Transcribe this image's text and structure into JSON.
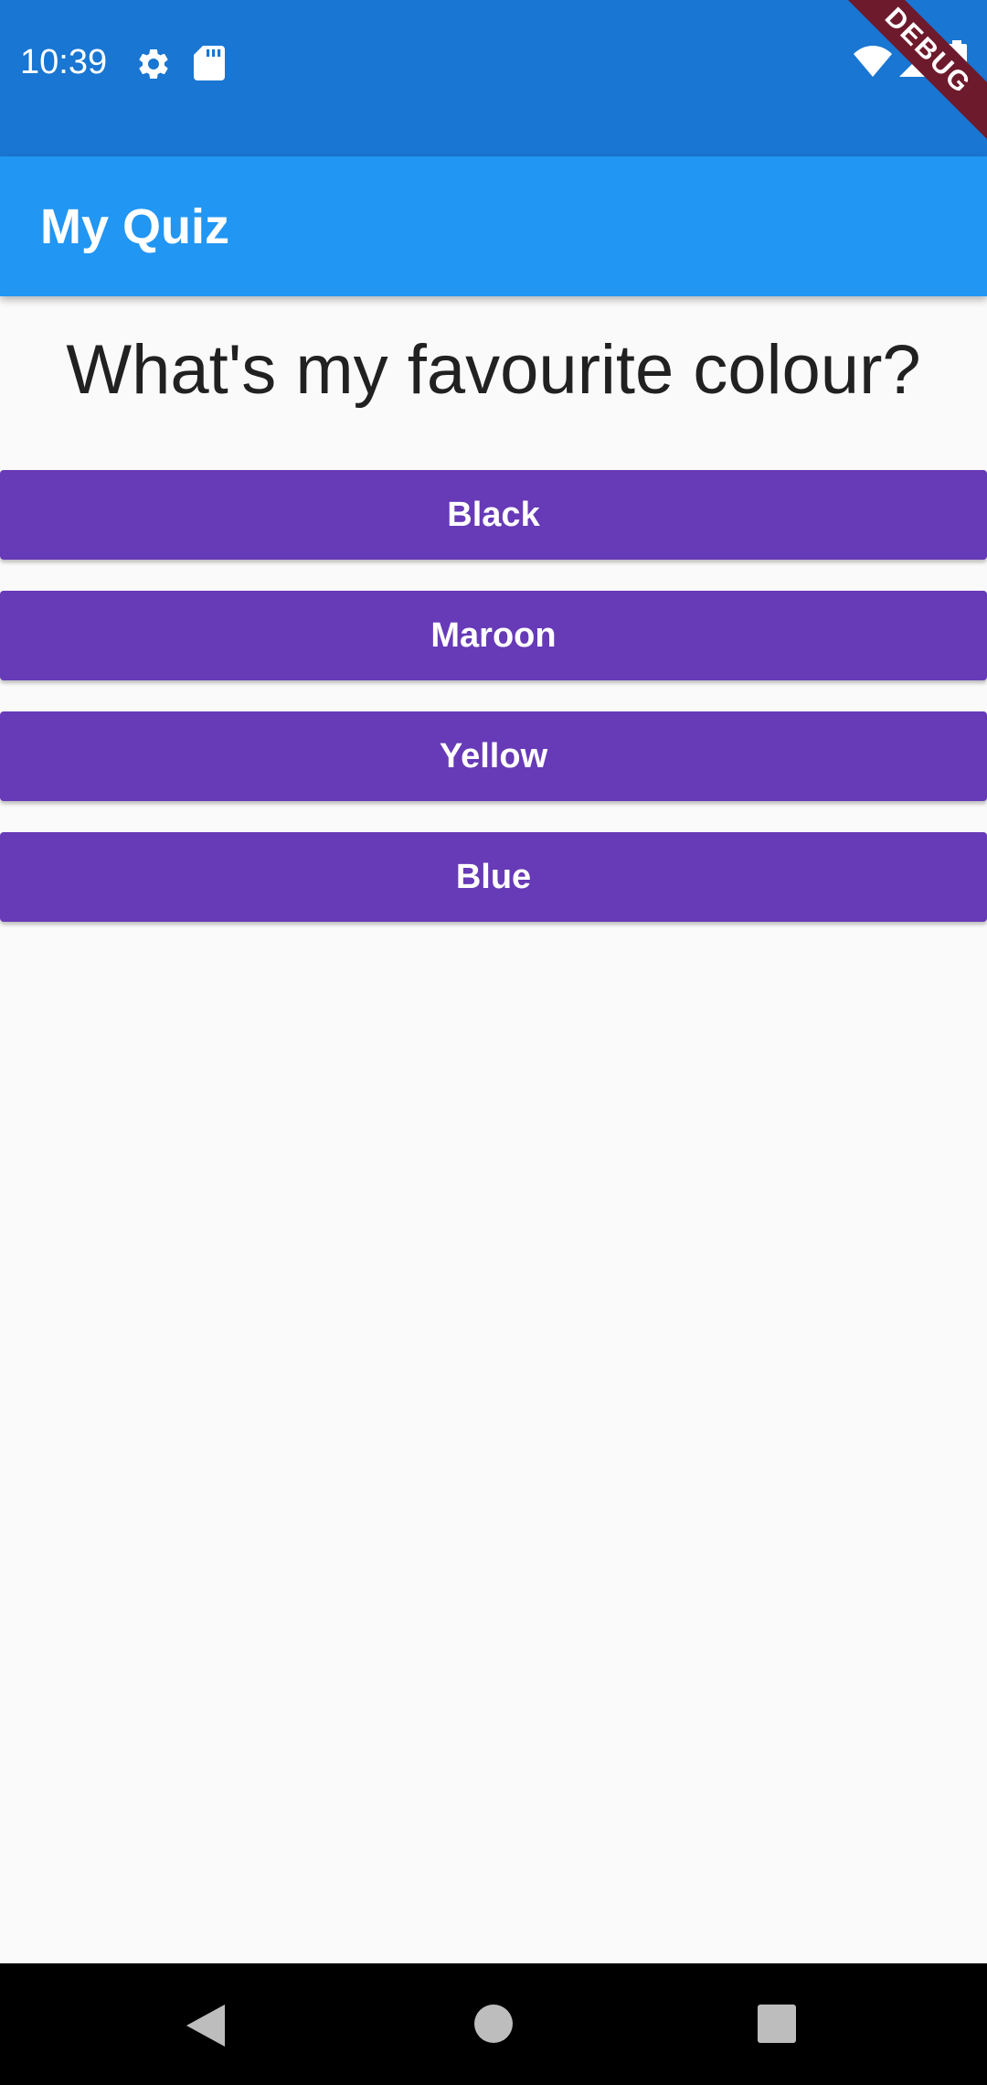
{
  "status_bar": {
    "time": "10:39",
    "icons": [
      "gear-icon",
      "sd-card-icon",
      "wifi-icon",
      "signal-icon",
      "battery-icon"
    ],
    "color": "#1976d2"
  },
  "debug_banner": {
    "label": "DEBUG"
  },
  "app_bar": {
    "title": "My Quiz",
    "color": "#2196f3"
  },
  "question": {
    "text": "What's my favourite colour?"
  },
  "answers": [
    {
      "label": "Black"
    },
    {
      "label": "Maroon"
    },
    {
      "label": "Yellow"
    },
    {
      "label": "Blue"
    }
  ],
  "answer_button_color": "#673ab7",
  "nav_bar": {
    "icons": [
      "back-icon",
      "home-icon",
      "recents-icon"
    ]
  }
}
